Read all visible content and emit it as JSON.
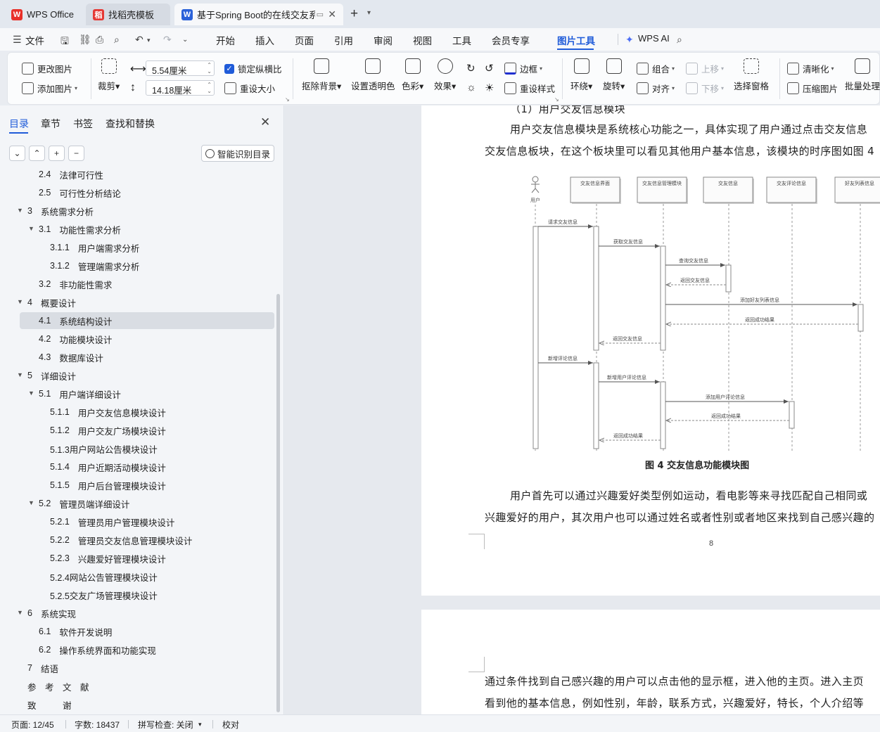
{
  "tabs": [
    {
      "label": "WPS Office",
      "icon": "wps-logo-icon"
    },
    {
      "label": "找稻壳模板",
      "icon": "docer-logo-icon"
    },
    {
      "label": "基于Spring Boot的在线交友系",
      "icon": "word-doc-icon"
    }
  ],
  "menu": {
    "file": "文件",
    "items": [
      "开始",
      "插入",
      "页面",
      "引用",
      "审阅",
      "视图",
      "工具",
      "会员专享",
      "图片工具"
    ],
    "wps_ai": "WPS AI",
    "accent": "#1f5bd9"
  },
  "ribbon": {
    "change_image": "更改图片",
    "add_image": "添加图片",
    "crop": "裁剪",
    "combine": "组合",
    "width_value": "5.54厘米",
    "height_value": "14.18厘米",
    "lock_ratio": "锁定纵横比",
    "reset_size": "重设大小",
    "remove_bg": "抠除背景",
    "set_transparent": "设置透明色",
    "color": "色彩",
    "effect": "效果",
    "border": "边框",
    "reset_style": "重设样式",
    "wrap": "环绕",
    "rotate": "旋转",
    "group": "组合",
    "align": "对齐",
    "move_up": "上移",
    "move_down": "下移",
    "selection_pane": "选择窗格",
    "sharpen": "清晰化",
    "compress": "压缩图片",
    "batch": "批量处理"
  },
  "nav": {
    "tabs": [
      "目录",
      "章节",
      "书签",
      "查找和替换"
    ],
    "smart_toc": "智能识别目录",
    "toc": [
      {
        "num": "2.4",
        "label": "法律可行性",
        "level": 2,
        "arrow": ""
      },
      {
        "num": "2.5",
        "label": "可行性分析结论",
        "level": 2,
        "arrow": ""
      },
      {
        "num": "3",
        "label": "系统需求分析",
        "level": 1,
        "arrow": "▼"
      },
      {
        "num": "3.1",
        "label": "功能性需求分析",
        "level": 2,
        "arrow": "▼"
      },
      {
        "num": "3.1.1",
        "label": "用户端需求分析",
        "level": 3,
        "arrow": ""
      },
      {
        "num": "3.1.2",
        "label": "管理端需求分析",
        "level": 3,
        "arrow": ""
      },
      {
        "num": "3.2",
        "label": "非功能性需求",
        "level": 2,
        "arrow": ""
      },
      {
        "num": "4",
        "label": "概要设计",
        "level": 1,
        "arrow": "▼"
      },
      {
        "num": "4.1",
        "label": "系统结构设计",
        "level": 2,
        "arrow": ""
      },
      {
        "num": "4.2",
        "label": "功能模块设计",
        "level": 2,
        "arrow": ""
      },
      {
        "num": "4.3",
        "label": "数据库设计",
        "level": 2,
        "arrow": ""
      },
      {
        "num": "5",
        "label": "详细设计",
        "level": 1,
        "arrow": "▼"
      },
      {
        "num": "5.1",
        "label": "用户端详细设计",
        "level": 2,
        "arrow": "▼"
      },
      {
        "num": "5.1.1",
        "label": "用户交友信息模块设计",
        "level": 3,
        "arrow": ""
      },
      {
        "num": "5.1.2",
        "label": "用户交友广场模块设计",
        "level": 3,
        "arrow": ""
      },
      {
        "num": "",
        "label": "5.1.3用户网站公告模块设计",
        "level": 3,
        "arrow": ""
      },
      {
        "num": "5.1.4",
        "label": "用户近期活动模块设计",
        "level": 3,
        "arrow": ""
      },
      {
        "num": "5.1.5",
        "label": "用户后台管理模块设计",
        "level": 3,
        "arrow": ""
      },
      {
        "num": "5.2",
        "label": "管理员端详细设计",
        "level": 2,
        "arrow": "▼"
      },
      {
        "num": "5.2.1",
        "label": "管理员用户管理模块设计",
        "level": 3,
        "arrow": ""
      },
      {
        "num": "5.2.2",
        "label": "管理员交友信息管理模块设计",
        "level": 3,
        "arrow": ""
      },
      {
        "num": "5.2.3",
        "label": "兴趣爱好管理模块设计",
        "level": 3,
        "arrow": ""
      },
      {
        "num": "",
        "label": "5.2.4网站公告管理模块设计",
        "level": 3,
        "arrow": ""
      },
      {
        "num": "",
        "label": "5.2.5交友广场管理模块设计",
        "level": 3,
        "arrow": ""
      },
      {
        "num": "6",
        "label": "系统实现",
        "level": 1,
        "arrow": "▼"
      },
      {
        "num": "6.1",
        "label": "软件开发说明",
        "level": 2,
        "arrow": ""
      },
      {
        "num": "6.2",
        "label": "操作系统界面和功能实现",
        "level": 2,
        "arrow": ""
      },
      {
        "num": "7",
        "label": "结语",
        "level": 1,
        "arrow": ""
      },
      {
        "num": "",
        "label": "参　考　文　献",
        "level": 1,
        "arrow": ""
      },
      {
        "num": "",
        "label": "致　　　谢",
        "level": 1,
        "arrow": ""
      }
    ]
  },
  "doc": {
    "partial_heading": "（1）用户交友信息模块",
    "para1_line1": "用户交友信息模块是系统核心功能之一，具体实现了用户通过点击交友信息",
    "para1_line2": "交友信息板块，在这个板块里可以看见其他用户基本信息，该模块的时序图如图 4",
    "figure_caption": "图 4  交友信息功能模块图",
    "para2_line1": "用户首先可以通过兴趣爱好类型例如运动，看电影等来寻找匹配自己相同或",
    "para2_line2": "兴趣爱好的用户，其次用户也可以通过姓名或者性别或者地区来找到自己感兴趣的",
    "page_number": "8",
    "page2_line1": "通过条件找到自己感兴趣的用户可以点击他的显示框，进入他的主页。进入主页",
    "page2_line2": "看到他的基本信息，例如性别，年龄，联系方式，兴趣爱好，特长，个人介绍等"
  },
  "diagram": {
    "actor": "用户",
    "lifelines": [
      "交友信息界面",
      "交友信息管理模块",
      "交友信息",
      "交友评论信息",
      "好友列表信息"
    ],
    "messages": [
      "请求交友信息",
      "获取交友信息",
      "查询交友信息",
      "返回交友信息",
      "添加好友列表信息",
      "返回成功结果",
      "返回交友信息",
      "新增评论信息",
      "新增用户评论信息",
      "添加用户评论信息",
      "返回成功结果",
      "返回成功结果"
    ]
  },
  "status": {
    "page": "页面: 12/45",
    "words": "字数: 18437",
    "spell": "拼写检查: 关闭",
    "proof": "校对"
  }
}
